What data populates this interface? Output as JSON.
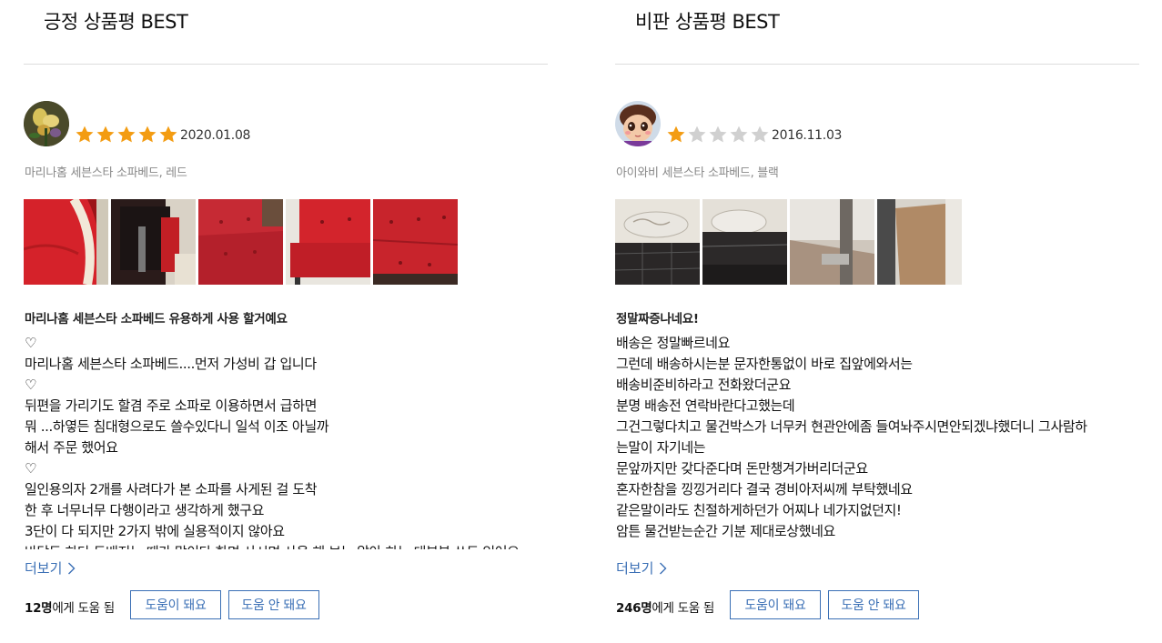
{
  "positive": {
    "section_title": "긍정 상품평 BEST",
    "rating": 5,
    "date": "2020.01.08",
    "option": "마리나홈 세븐스타 소파베드, 레드",
    "headline": "마리나홈 세븐스타 소파베드 유용하게 사용 할거예요",
    "body_lines": [
      "♡",
      "마리나홈 세븐스타 소파베드....먼저 가성비 갑 입니다",
      "♡",
      "뒤편을 가리기도 할겸 주로 소파로 이용하면서 급하면",
      "뭐 ...하옇든 침대형으로도 쓸수있다니 일석 이조 아닐까",
      "해서 주문 했어요",
      "♡",
      "일인용의자 2개를 사려다가 본 소파를 사게된 걸 도착",
      "한 후 너무너무 다행이라고 생각하게 했구요",
      "3단이 다 되지만 2가지 밖에 실용적이지 않아요",
      "바닥도 하단 도배지는 때가 많이타 한면 사시면 사용 해 보는 알아 하는 대부분 쓰도 있어요"
    ],
    "more_label": "더보기",
    "helpful_count": "12명",
    "helpful_suffix": "에게 도움 됨",
    "helpful_yes": "도움이 돼요",
    "helpful_no": "도움 안 돼요"
  },
  "critical": {
    "section_title": "비판 상품평 BEST",
    "rating": 1,
    "date": "2016.11.03",
    "option": "아이와비 세븐스타 소파베드, 블랙",
    "headline": "정말짜증나네요!",
    "body_lines": [
      "배송은 정말빠르네요",
      "그런데 배송하시는분 문자한통없이 바로 집앞에와서는",
      "배송비준비하라고 전화왔더군요",
      "분명 배송전 연락바란다고했는데",
      "그건그렇다치고 물건박스가 너무커 현관안에좀 들여놔주시면안되겠냐했더니 그사람하",
      "는말이 자기네는",
      "문앞까지만 갖다준다며 돈만챙겨가버리더군요",
      "혼자한참을 낑낑거리다 결국 경비아저씨께 부탁했네요",
      "같은말이라도 친절하게하던가 어찌나 네가지없던지!",
      "암튼 물건받는순간 기분 제대로상했네요"
    ],
    "more_label": "더보기",
    "helpful_count": "246명",
    "helpful_suffix": "에게 도움 됨",
    "helpful_yes": "도움이 돼요",
    "helpful_no": "도움 안 돼요"
  },
  "colors": {
    "star_on": "#f39c12",
    "star_off": "#d0d0d0",
    "link": "#3a6fb5",
    "divider": "#dcdcdc"
  },
  "icons": {
    "star": "star-icon",
    "more": "chevron-right-icon"
  }
}
